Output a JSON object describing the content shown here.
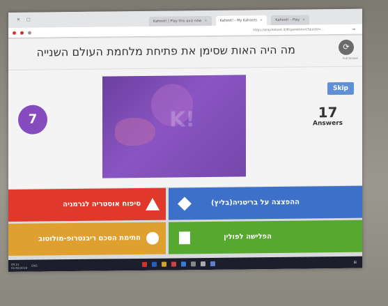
{
  "browser": {
    "tabs": [
      {
        "label": "Kahoot! | Play this quiz now",
        "active": false
      },
      {
        "label": "Kahoot! - My Kahoots",
        "active": true
      },
      {
        "label": "Kahoot! - Play",
        "active": false
      }
    ],
    "address": "https://play.kahoot.it/#/gameblock?quizId=..."
  },
  "question": {
    "text": "מה היה האות שסימן את פתיחת מלחמת העולם השנייה",
    "fullscreen_label": "Full Screen"
  },
  "stage": {
    "timer": "7",
    "answers_count": "17",
    "answers_label": "Answers",
    "skip_label": "Skip"
  },
  "answers": [
    {
      "text": "סיפוח אוסטריה לגרמניה",
      "color": "#e0392b",
      "shape": "triangle"
    },
    {
      "text": "ההפצצה על בריטניה(בליץ)",
      "color": "#3d70c8",
      "shape": "diamond"
    },
    {
      "text": "חתימת הסכם ריבנטרופ-מולוטוב",
      "color": "#e0a030",
      "shape": "circle"
    },
    {
      "text": "הפלישה לפולין",
      "color": "#56a82f",
      "shape": "square"
    }
  ],
  "taskbar": {
    "time": "09:21",
    "date": "01/02/2018",
    "lang": "ENG"
  }
}
